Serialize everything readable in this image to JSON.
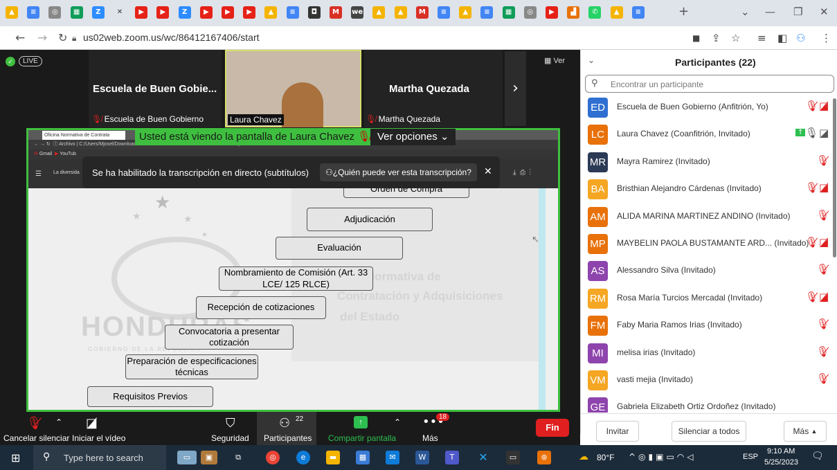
{
  "browser": {
    "url": "us02web.zoom.us/wc/86412167406/start",
    "tab_icons": [
      {
        "icon": "drive-icon",
        "color": "#f4b400",
        "glyph": "▲"
      },
      {
        "icon": "docs-icon",
        "color": "#4285f4",
        "glyph": "≡"
      },
      {
        "icon": "chrome-icon",
        "color": "#888888",
        "glyph": "◎"
      },
      {
        "icon": "sheets-icon",
        "color": "#0f9d58",
        "glyph": "▦"
      },
      {
        "icon": "zoom-icon",
        "color": "#2d8cff",
        "glyph": "Z"
      },
      {
        "icon": "close-icon",
        "color": "#dfe3ea",
        "glyph": "✕"
      },
      {
        "icon": "youtube-icon",
        "color": "#e62117",
        "glyph": "▶"
      },
      {
        "icon": "youtube-icon",
        "color": "#e62117",
        "glyph": "▶"
      },
      {
        "icon": "zoom-icon",
        "color": "#2d8cff",
        "glyph": "Z"
      },
      {
        "icon": "youtube-icon",
        "color": "#e62117",
        "glyph": "▶"
      },
      {
        "icon": "youtube-icon",
        "color": "#e62117",
        "glyph": "▶"
      },
      {
        "icon": "youtube-icon",
        "color": "#e62117",
        "glyph": "▶"
      },
      {
        "icon": "drive-icon",
        "color": "#f4b400",
        "glyph": "▲"
      },
      {
        "icon": "docs-icon",
        "color": "#4285f4",
        "glyph": "≡"
      },
      {
        "icon": "app-icon",
        "color": "#333333",
        "glyph": "◘"
      },
      {
        "icon": "gmail-icon",
        "color": "#d93025",
        "glyph": "M"
      },
      {
        "icon": "we-icon",
        "color": "#444444",
        "glyph": "we"
      },
      {
        "icon": "drive-icon",
        "color": "#f4b400",
        "glyph": "▲"
      },
      {
        "icon": "drive-icon",
        "color": "#f4b400",
        "glyph": "▲"
      },
      {
        "icon": "gmail-icon",
        "color": "#d93025",
        "glyph": "M"
      },
      {
        "icon": "docs-icon",
        "color": "#4285f4",
        "glyph": "≡"
      },
      {
        "icon": "drive-icon",
        "color": "#f4b400",
        "glyph": "▲"
      },
      {
        "icon": "docs-icon",
        "color": "#4285f4",
        "glyph": "≡"
      },
      {
        "icon": "sheets-icon",
        "color": "#0f9d58",
        "glyph": "▦"
      },
      {
        "icon": "chrome-icon",
        "color": "#888888",
        "glyph": "◎"
      },
      {
        "icon": "youtube-icon",
        "color": "#e62117",
        "glyph": "▶"
      },
      {
        "icon": "chart-icon",
        "color": "#e8710a",
        "glyph": "▟"
      },
      {
        "icon": "whatsapp-icon",
        "color": "#25d366",
        "glyph": "✆"
      },
      {
        "icon": "drive-icon",
        "color": "#f4b400",
        "glyph": "▲"
      },
      {
        "icon": "docs-icon",
        "color": "#4285f4",
        "glyph": "≡"
      }
    ],
    "new_tab": "+"
  },
  "zoom": {
    "live_badge": "LIVE",
    "view_button": "Ver",
    "tiles": [
      {
        "name": "Escuela de Buen Gobie...",
        "label": "Escuela de Buen Gobierno"
      },
      {
        "name": "",
        "label": "Laura Chavez"
      },
      {
        "name": "Martha Quezada",
        "label": "Martha Quezada"
      }
    ],
    "share_banner": "Usted está viendo la pantalla de Laura Chavez",
    "view_options": "Ver opciones",
    "caption_notice": "Se ha habilitado la transcripción en directo (subtítulos)",
    "caption_who": "¿Quién puede ver esta transcripción?",
    "inner_browser": {
      "tab1": "Oficina Normativa de Contrata",
      "path": "C:/Users/Mjosel/Downloads/COMPRAS%20MENORES%20-%20ONCAE.pdf",
      "archivo": "Archivo",
      "bookmarks": [
        "Gmail",
        "YouTub"
      ],
      "doc_title": "La diversida"
    },
    "watermark": {
      "line1": "Normativa de",
      "line2": "Contratación y Adquisiciones",
      "line3": "del Estado",
      "honduras": "HONDURAS",
      "gobierno": "GOBIERNO DE LA REPÚBLICA"
    },
    "flow_steps": [
      "Orden de Compra",
      "Adjudicación",
      "Evaluación",
      "Nombramiento de Comisión (Art. 33 LCE/ 125 RLCE)",
      "Recepción de cotizaciones",
      "Convocatoria a presentar cotización",
      "Preparación de especificaciones técnicas",
      "Requisitos Previos"
    ],
    "toolbar": {
      "unmute": "Cancelar silenciar",
      "start_video": "Iniciar el vídeo",
      "security": "Seguridad",
      "participants": "Participantes",
      "participants_count": "22",
      "share": "Compartir pantalla",
      "more": "Más",
      "more_badge": "18",
      "end": "Fin"
    }
  },
  "participants_panel": {
    "title": "Participantes (22)",
    "search_placeholder": "Encontrar un participante",
    "list": [
      {
        "initials": "ED",
        "name": "Escuela de Buen Gobierno (Anfitrión, Yo)",
        "color": "#2f6fd1",
        "mic": "muted",
        "video": "off"
      },
      {
        "initials": "LC",
        "name": "Laura Chavez (Coanfitrión, Invitado)",
        "color": "#e8710a",
        "mic": "on",
        "video": "on"
      },
      {
        "initials": "MR",
        "name": "Mayra Ramirez (Invitado)",
        "color": "#2b3a55",
        "mic": "muted",
        "video": ""
      },
      {
        "initials": "BA",
        "name": "Bristhian Alejandro Cárdenas (Invitado)",
        "color": "#f5a623",
        "mic": "muted",
        "video": "off"
      },
      {
        "initials": "AM",
        "name": "ALIDA MARINA MARTINEZ ANDINO (Invitado)",
        "color": "#e8710a",
        "mic": "muted",
        "video": ""
      },
      {
        "initials": "MP",
        "name": "MAYBELIN PAOLA BUSTAMANTE ARD... (Invitado)",
        "color": "#e8710a",
        "mic": "muted",
        "video": "off"
      },
      {
        "initials": "AS",
        "name": "Alessandro Silva (Invitado)",
        "color": "#8e44ad",
        "mic": "muted",
        "video": ""
      },
      {
        "initials": "RM",
        "name": "Rosa María Turcios Mercadal (Invitado)",
        "color": "#f5a623",
        "mic": "muted",
        "video": "off"
      },
      {
        "initials": "FM",
        "name": "Faby Maria Ramos Irias (Invitado)",
        "color": "#e8710a",
        "mic": "muted",
        "video": ""
      },
      {
        "initials": "MI",
        "name": "melisa irias (Invitado)",
        "color": "#8e44ad",
        "mic": "muted",
        "video": ""
      },
      {
        "initials": "VM",
        "name": "vasti mejia (Invitado)",
        "color": "#f5a623",
        "mic": "muted",
        "video": ""
      },
      {
        "initials": "GE",
        "name": "Gabriela Elizabeth Ortiz Ordoñez (Invitado)",
        "color": "#8e44ad",
        "mic": "",
        "video": ""
      }
    ],
    "invite": "Invitar",
    "mute_all": "Silenciar a todos",
    "more": "Más"
  },
  "taskbar": {
    "search_placeholder": "Type here to search",
    "weather": "80°F",
    "lang": "ESP",
    "time": "9:10 AM",
    "date": "5/25/2023"
  }
}
